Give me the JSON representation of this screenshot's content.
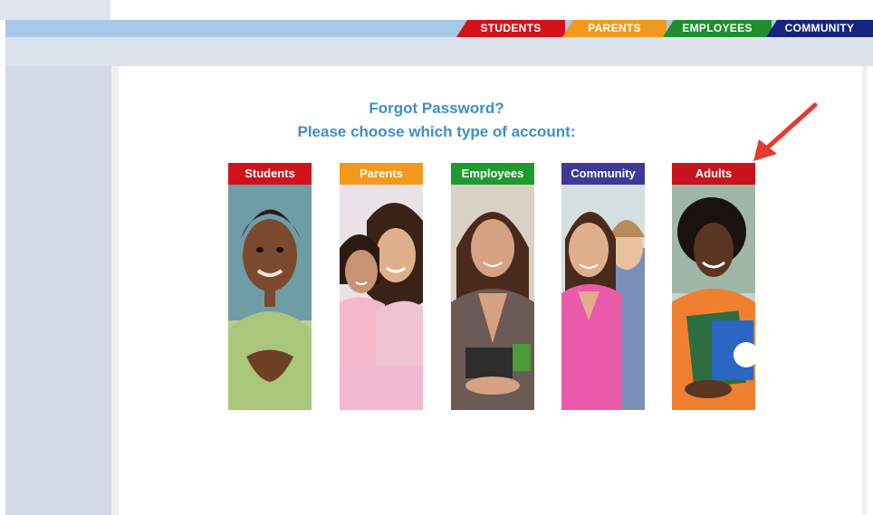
{
  "nav": {
    "tabs": [
      {
        "label": "STUDENTS",
        "color": "#d1121b"
      },
      {
        "label": "PARENTS",
        "color": "#f39a1d"
      },
      {
        "label": "EMPLOYEES",
        "color": "#1f8f2e"
      },
      {
        "label": "COMMUNITY",
        "color": "#17237e"
      }
    ]
  },
  "page": {
    "heading": "Forgot Password?",
    "subheading": "Please choose which type of account:"
  },
  "accounts": [
    {
      "label": "Students",
      "color": "#d1121b"
    },
    {
      "label": "Parents",
      "color": "#f39a1d"
    },
    {
      "label": "Employees",
      "color": "#1f9a2e"
    },
    {
      "label": "Community",
      "color": "#3c3a96"
    },
    {
      "label": "Adults",
      "color": "#c8141f"
    }
  ],
  "annotation": {
    "icon": "red-arrow-icon",
    "color": "#e53a2f"
  }
}
